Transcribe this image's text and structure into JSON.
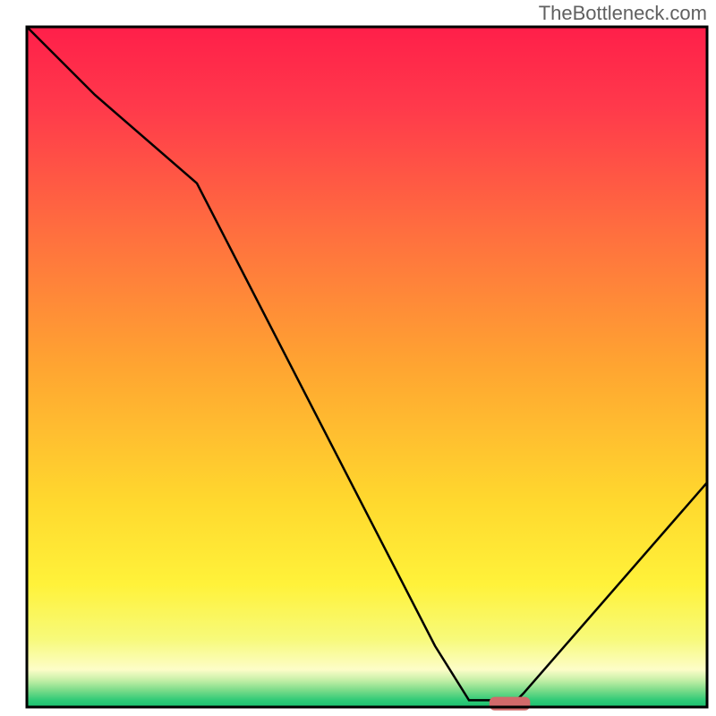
{
  "watermark": "TheBottleneck.com",
  "chart_data": {
    "type": "line",
    "title": "",
    "xlabel": "",
    "ylabel": "",
    "xlim": [
      0,
      100
    ],
    "ylim": [
      0,
      100
    ],
    "curve": {
      "name": "bottleneck-curve",
      "x": [
        0,
        10,
        25,
        60,
        65,
        72,
        73,
        100
      ],
      "y": [
        100,
        90,
        77,
        9,
        1,
        1,
        2,
        33
      ]
    },
    "curve_color": "#000000",
    "optimum_marker": {
      "x": 71,
      "y": 0.5,
      "width": 6,
      "height": 2,
      "color": "#d16a6a"
    },
    "gradient_stops": [
      {
        "offset": 0.0,
        "color": "#ff1f4a"
      },
      {
        "offset": 0.12,
        "color": "#ff3a4b"
      },
      {
        "offset": 0.3,
        "color": "#ff6e3f"
      },
      {
        "offset": 0.5,
        "color": "#ffa531"
      },
      {
        "offset": 0.7,
        "color": "#ffd92e"
      },
      {
        "offset": 0.82,
        "color": "#fff23a"
      },
      {
        "offset": 0.9,
        "color": "#f7fa7a"
      },
      {
        "offset": 0.945,
        "color": "#fdfdc8"
      },
      {
        "offset": 0.96,
        "color": "#c7f0a8"
      },
      {
        "offset": 0.975,
        "color": "#7ddc8a"
      },
      {
        "offset": 0.99,
        "color": "#2fca77"
      },
      {
        "offset": 1.0,
        "color": "#18c06f"
      }
    ],
    "frame_color": "#000000",
    "frame_width": 3
  }
}
